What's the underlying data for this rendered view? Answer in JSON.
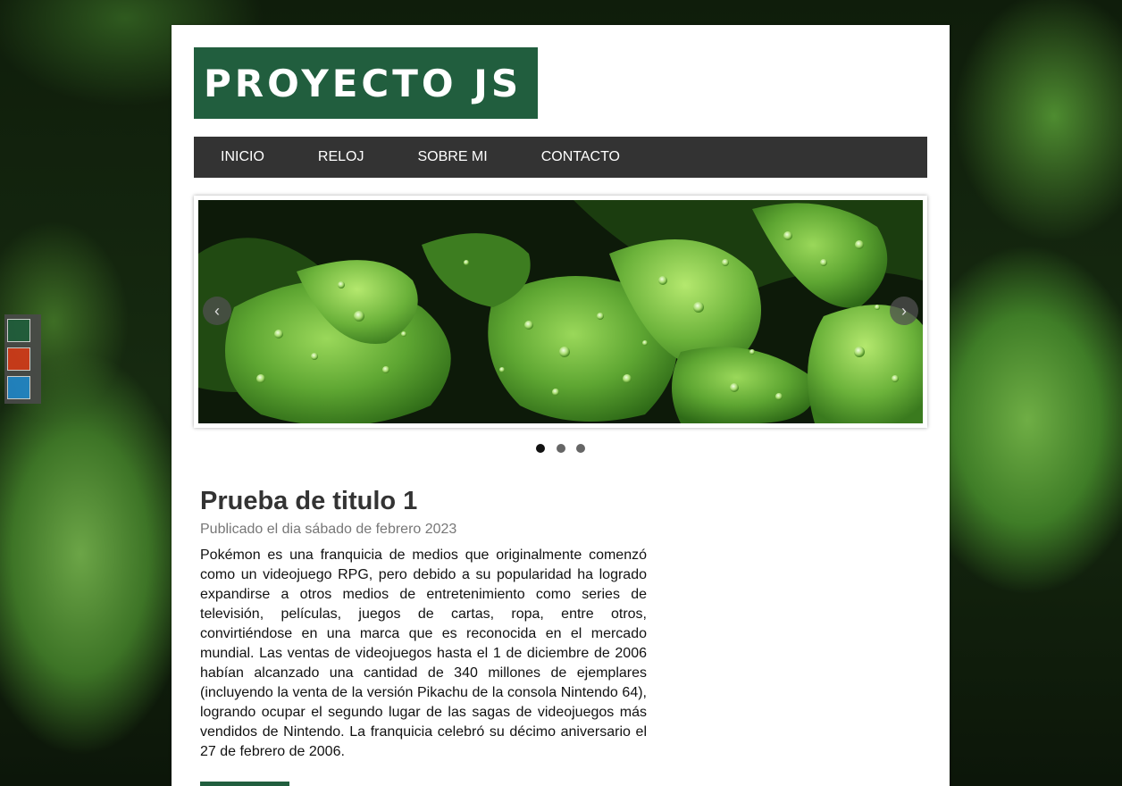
{
  "site": {
    "title": "PROYECTO JS"
  },
  "nav": {
    "items": [
      "INICIO",
      "RELOJ",
      "SOBRE MI",
      "CONTACTO"
    ]
  },
  "theme_switcher": {
    "colors": [
      "#215e3e",
      "#d63a1a",
      "#2288cc"
    ]
  },
  "slider": {
    "prev_icon": "chevron-left-icon",
    "next_icon": "chevron-right-icon",
    "prev_symbol": "‹",
    "next_symbol": "›",
    "slide_count": 3,
    "active_index": 0
  },
  "article": {
    "title": "Prueba de titulo 1",
    "meta": "Publicado el dia sábado de febrero 2023",
    "body": "Pokémon es una franquicia de medios que originalmente comenzó como un videojuego RPG, pero debido a su popularidad ha logrado expandirse a otros medios de entretenimiento como series de televisión, películas, juegos de cartas, ropa, entre otros, convirtiéndose en una marca que es reconocida en el mercado mundial. Las ventas de videojuegos hasta el 1 de diciembre de 2006 habían alcanzado una cantidad de 340 millones de ejemplares (incluyendo la venta de la versión Pikachu de la consola Nintendo 64), logrando ocupar el segundo lugar de las sagas de videojuegos más vendidos de Nintendo. La franquicia celebró su décimo aniversario el 27 de febrero de 2006."
  },
  "colors": {
    "brand": "#215e3e",
    "menu_bg": "#333333"
  }
}
